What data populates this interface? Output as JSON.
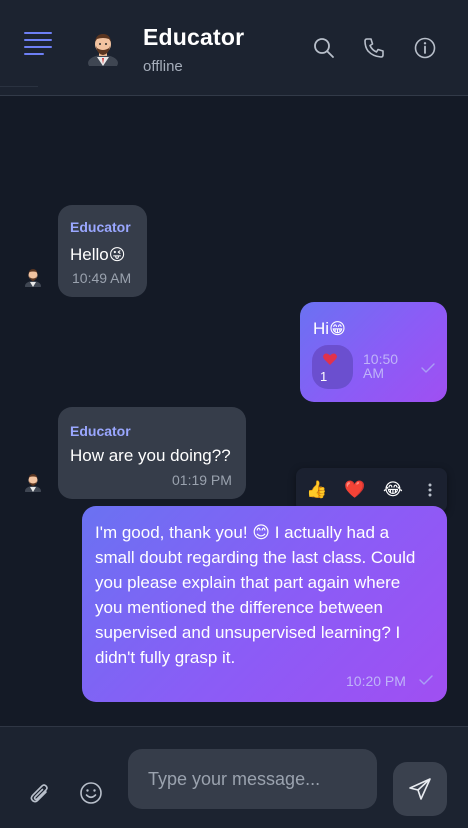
{
  "header": {
    "title": "Educator",
    "status": "offline"
  },
  "messages": [
    {
      "direction": "incoming",
      "sender": "Educator",
      "text": "Hello",
      "emoji": "😜",
      "time": "10:49 AM"
    },
    {
      "direction": "outgoing",
      "text": "Hi",
      "emoji": "😁",
      "time": "10:50 AM",
      "time_line1": "10:50",
      "time_line2": "AM",
      "reaction": {
        "emoji": "❤️",
        "count": "1"
      },
      "read": true
    },
    {
      "direction": "incoming",
      "sender": "Educator",
      "text": "How are you doing??",
      "time": "01:19 PM"
    },
    {
      "direction": "outgoing",
      "text_lines": [
        "I'm good, thank you! 😊 I actually had a",
        "small doubt regarding the last class. Could",
        "you please explain that part again where",
        "you mentioned the difference between",
        "supervised and unsupervised learning? I",
        "didn't fully grasp it."
      ],
      "time": "10:20 PM",
      "read": true
    }
  ],
  "reaction_bar": {
    "options": [
      "👍",
      "❤️",
      "😂"
    ]
  },
  "composer": {
    "placeholder": "Type your message..."
  },
  "colors": {
    "background": "#141a26",
    "header": "#1c2330",
    "incoming_bubble": "#363d4a",
    "outgoing_gradient_start": "#6a72f2",
    "outgoing_gradient_end": "#a04ff2",
    "accent": "#6d7ff5",
    "sender_name": "#9aa7ff"
  },
  "icons": [
    "menu-icon",
    "avatar",
    "search-icon",
    "phone-icon",
    "info-icon",
    "check-icon",
    "attach-icon",
    "smiley-icon",
    "send-icon",
    "kebab-icon"
  ]
}
